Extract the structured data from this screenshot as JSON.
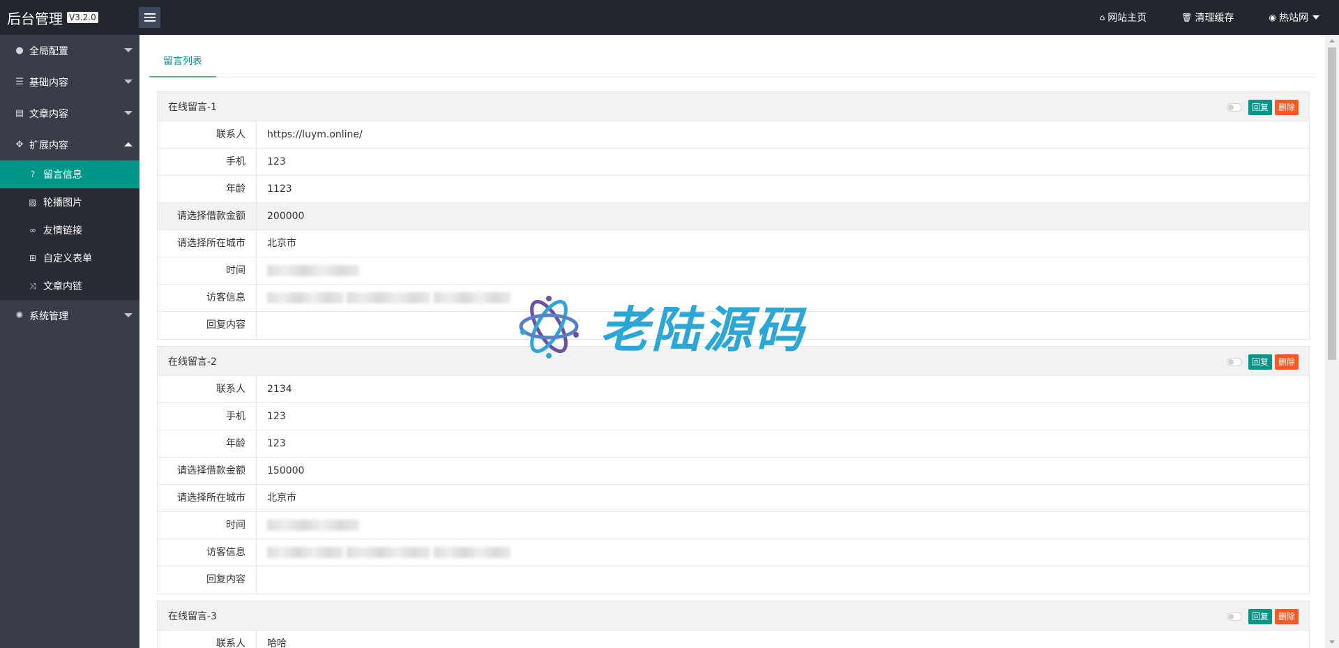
{
  "header": {
    "logo": "后台管理",
    "version": "V3.2.0",
    "links": [
      {
        "icon": "home-icon",
        "glyph": "⌂",
        "label": "网站主页"
      },
      {
        "icon": "trash-icon",
        "glyph": "🗑",
        "label": "清理缓存"
      },
      {
        "icon": "user-icon",
        "glyph": "◉",
        "label": "热站网"
      }
    ]
  },
  "sidebar": {
    "groups": [
      {
        "icon": "globe-icon",
        "glyph": "●",
        "label": "全局配置"
      },
      {
        "icon": "sliders-icon",
        "glyph": "☰",
        "label": "基础内容"
      },
      {
        "icon": "file-icon",
        "glyph": "▤",
        "label": "文章内容"
      },
      {
        "icon": "expand-icon",
        "glyph": "✥",
        "label": "扩展内容"
      },
      {
        "icon": "cog-icon",
        "glyph": "✺",
        "label": "系统管理"
      }
    ],
    "sub_items": [
      {
        "icon": "question-icon",
        "glyph": "?",
        "label": "留言信息"
      },
      {
        "icon": "image-icon",
        "glyph": "▨",
        "label": "轮播图片"
      },
      {
        "icon": "link-icon",
        "glyph": "∞",
        "label": "友情链接"
      },
      {
        "icon": "table-icon",
        "glyph": "⊞",
        "label": "自定义表单"
      },
      {
        "icon": "random-icon",
        "glyph": "⤨",
        "label": "文章内链"
      }
    ]
  },
  "main": {
    "tab": "留言列表",
    "buttons": {
      "reply": "回复",
      "delete": "删除"
    },
    "messages": [
      {
        "title": "在线留言-1",
        "rows": [
          {
            "label": "联系人",
            "value": "https://luym.online/"
          },
          {
            "label": "手机",
            "value": "123"
          },
          {
            "label": "年龄",
            "value": "1123"
          },
          {
            "label": "请选择借款金额",
            "value": "200000"
          },
          {
            "label": "请选择所在城市",
            "value": "北京市"
          },
          {
            "label": "时间",
            "value": ""
          },
          {
            "label": "访客信息",
            "value": ""
          },
          {
            "label": "回复内容",
            "value": ""
          }
        ]
      },
      {
        "title": "在线留言-2",
        "rows": [
          {
            "label": "联系人",
            "value": "2134"
          },
          {
            "label": "手机",
            "value": "123"
          },
          {
            "label": "年龄",
            "value": "123"
          },
          {
            "label": "请选择借款金额",
            "value": "150000"
          },
          {
            "label": "请选择所在城市",
            "value": "北京市"
          },
          {
            "label": "时间",
            "value": ""
          },
          {
            "label": "访客信息",
            "value": ""
          },
          {
            "label": "回复内容",
            "value": ""
          }
        ]
      },
      {
        "title": "在线留言-3",
        "rows": [
          {
            "label": "联系人",
            "value": "哈哈"
          }
        ]
      }
    ]
  },
  "watermark": "老陆源码",
  "colors": {
    "header": "#23262e",
    "sidebar": "#393d49",
    "active": "#009688",
    "danger": "#FF5722"
  }
}
